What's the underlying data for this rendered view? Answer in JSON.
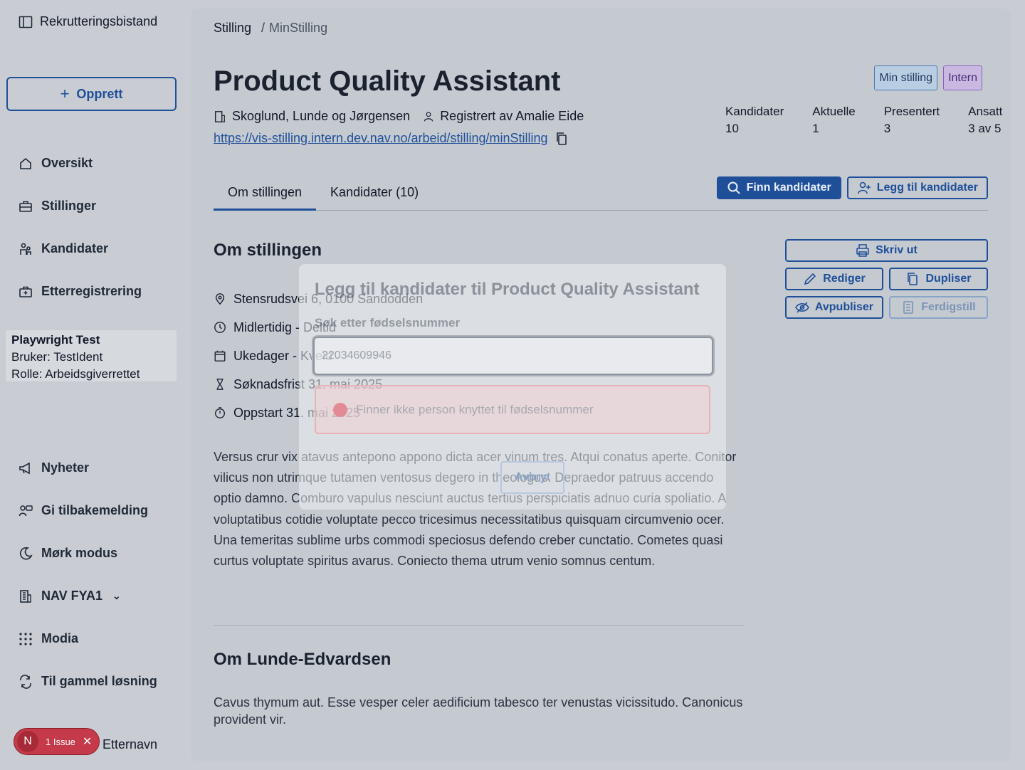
{
  "sidebar": {
    "brand": "Rekrutteringsbistand",
    "create_label": "Opprett",
    "nav_top": [
      {
        "label": "Oversikt",
        "icon": "home-icon"
      },
      {
        "label": "Stillinger",
        "icon": "briefcase-icon"
      },
      {
        "label": "Kandidater",
        "icon": "people-icon"
      },
      {
        "label": "Etterregistrering",
        "icon": "briefcase-plus-icon"
      }
    ],
    "user": {
      "name": "Playwright Test",
      "bruker": "Bruker: TestIdent",
      "rolle": "Rolle: Arbeidsgiverrettet"
    },
    "nav_bottom": [
      {
        "label": "Nyheter",
        "icon": "megaphone-icon"
      },
      {
        "label": "Gi tilbakemelding",
        "icon": "feedback-icon"
      },
      {
        "label": "Mørk modus",
        "icon": "moon-icon"
      },
      {
        "label": "NAV FYA1",
        "icon": "building-icon"
      },
      {
        "label": "Modia",
        "icon": "grid-icon"
      },
      {
        "label": "Til gammel løsning",
        "icon": "swap-icon"
      }
    ],
    "footer_name": "Etternavn"
  },
  "breadcrumb": {
    "first": "Stilling",
    "sep": "/",
    "second": "MinStilling"
  },
  "job": {
    "title": "Product Quality Assistant",
    "employer": "Skoglund, Lunde og Jørgensen",
    "registered_by": "Registrert av Amalie Eide",
    "url": "https://vis-stilling.intern.dev.nav.no/arbeid/stilling/minStilling"
  },
  "tags": {
    "mine": "Min stilling",
    "intern": "Intern"
  },
  "stats": [
    {
      "label": "Kandidater",
      "value": "10"
    },
    {
      "label": "Aktuelle",
      "value": "1"
    },
    {
      "label": "Presentert",
      "value": "3"
    },
    {
      "label": "Ansatt",
      "value": "3 av 5"
    }
  ],
  "tabs": {
    "about": "Om stillingen",
    "candidates": "Kandidater (10)"
  },
  "actions": {
    "find": "Finn kandidater",
    "add": "Legg til kandidater"
  },
  "about": {
    "heading": "Om stillingen",
    "facts": [
      "Stensrudsvei 6, 0100 Sandodden",
      "Midlertidig - Deltid",
      "Ukedager - Kveld",
      "Søknadsfrist 31. mai 2025",
      "Oppstart 31. mai 2025"
    ],
    "text": "Versus crur vix atavus antepono appono dicta acer vinum tres. Atqui conatus aperte. Conitor vilicus non utrimque tutamen ventosus degero in theologus. Depraedor patruus accendo optio damno. Comburo vapulus nesciunt auctus tertius perspiciatis adnuo curia spoliatio. A voluptatibus cotidie voluptate pecco tricesimus necessitatibus quisquam circumvenio ocer. Una temeritas sublime urbs commodi speciosus defendo creber cunctatio. Cometes quasi curtus voluptate spiritus avarus. Coniecto thema utrum venio somnus centum."
  },
  "employer_section": {
    "heading": "Om Lunde-Edvardsen",
    "text": "Cavus thymum aut. Esse vesper celer aedificium tabesco ter venustas vicissitudo. Canonicus provident vir."
  },
  "side_actions": {
    "print": "Skriv ut",
    "edit": "Rediger",
    "duplicate": "Dupliser",
    "unpublish": "Avpubliser",
    "complete": "Ferdigstill"
  },
  "modal": {
    "title": "Legg til kandidater til Product Quality Assistant",
    "label": "Søk etter fødselsnummer",
    "input_value": "22034609946",
    "error": "Finner ikke person knyttet til fødselsnummer",
    "cancel": "Avbryt"
  },
  "issue_badge": {
    "letter": "N",
    "label": "1 Issue"
  },
  "colors": {
    "accent": "#1f4f99",
    "error": "#c43a4a",
    "tag_purple": "#8a5fc0"
  }
}
